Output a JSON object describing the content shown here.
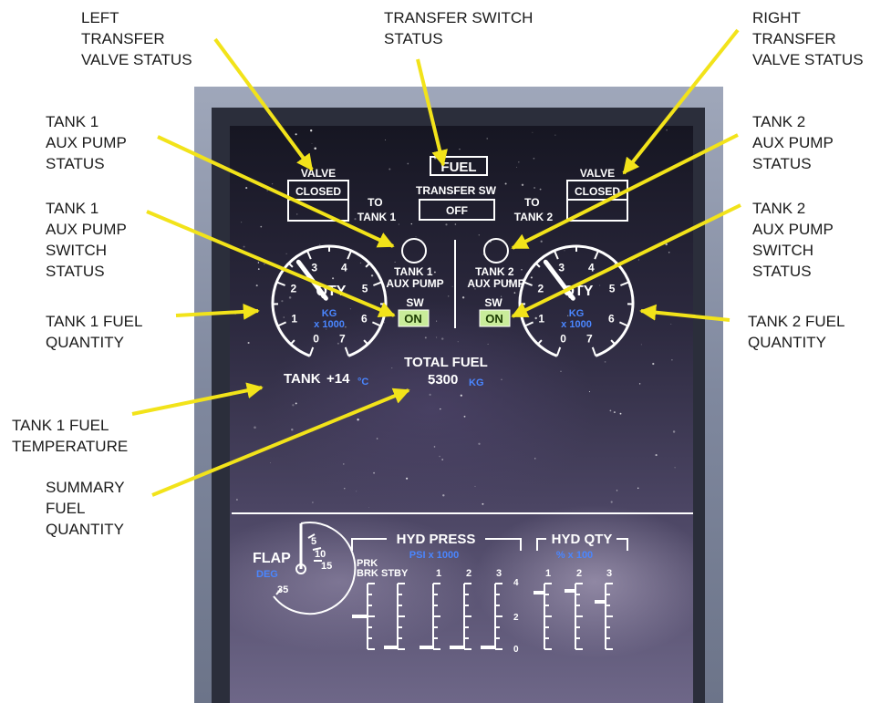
{
  "callouts": {
    "left_valve": "LEFT\nTRANSFER\nVALVE STATUS",
    "switch_status": "TRANSFER SWITCH\nSTATUS",
    "right_valve": "RIGHT\nTRANSFER\nVALVE STATUS",
    "tank1_aux_pump": "TANK 1\nAUX PUMP\nSTATUS",
    "tank2_aux_pump": "TANK 2\nAUX PUMP\nSTATUS",
    "tank1_aux_switch": "TANK 1\nAUX PUMP\nSWITCH\nSTATUS",
    "tank2_aux_switch": "TANK 2\nAUX PUMP\nSWITCH\nSTATUS",
    "tank1_qty": "TANK 1 FUEL\nQUANTITY",
    "tank2_qty": "TANK 2 FUEL\nQUANTITY",
    "tank1_temp": "TANK 1 FUEL\nTEMPERATURE",
    "summary_qty": "SUMMARY\nFUEL\nQUANTITY"
  },
  "display": {
    "fuel_title": "FUEL",
    "valve_label": "VALVE",
    "valve_left_state": "CLOSED",
    "valve_right_state": "CLOSED",
    "to_tank1": "TO\nTANK 1",
    "to_tank2": "TO\nTANK 2",
    "transfer_sw_label": "TRANSFER SW",
    "transfer_sw_state": "OFF",
    "tank1_pump_label": "TANK 1\nAUX PUMP",
    "tank2_pump_label": "TANK 2\nAUX PUMP",
    "sw_label": "SW",
    "tank1_sw_state": "ON",
    "tank2_sw_state": "ON",
    "qty_label": "QTY",
    "qty_unit": "KG",
    "qty_scale": "x 1000",
    "gauge_ticks": [
      "0",
      "1",
      "2",
      "3",
      "4",
      "5",
      "6",
      "7"
    ],
    "temp_label": "TANK",
    "temp_value": "+14",
    "temp_unit": "°C",
    "total_label": "TOTAL FUEL",
    "total_value": "5300",
    "total_unit": "KG",
    "flap_label": "FLAP",
    "flap_unit": "DEG",
    "flap_ticks": [
      "5",
      "10",
      "15",
      "35"
    ],
    "hyd_press_label": "HYD PRESS",
    "hyd_press_unit": "PSI x 1000",
    "hyd_press_cols": [
      "PRK\nBRK",
      "STBY",
      "1",
      "2",
      "3"
    ],
    "hyd_press_scale": [
      "4",
      "2",
      "0"
    ],
    "hyd_qty_label": "HYD QTY",
    "hyd_qty_unit": "% x 100",
    "hyd_qty_cols": [
      "1",
      "2",
      "3"
    ]
  },
  "colors": {
    "label_blue": "#4a86ff",
    "on_green": "#c9ec9a",
    "display_white": "#ffffff"
  }
}
